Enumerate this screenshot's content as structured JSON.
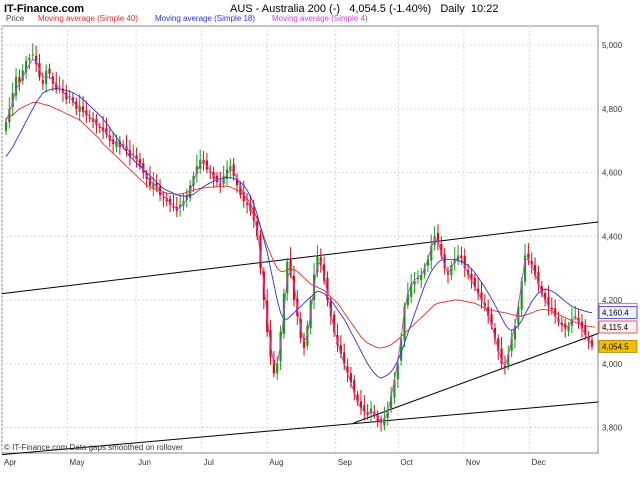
{
  "header": {
    "brand": "IT-Finance.com",
    "symbol": "AUS - Australia 200 (-)",
    "quote": "4,054.5 (-1.40%)",
    "period": "Daily",
    "time": "10:22"
  },
  "legend": {
    "price": "Price",
    "ma40": "Moving average (Simple 40)",
    "ma18": "Moving average (Simple 18)",
    "ma4": "Moving average (Simple 4)"
  },
  "footer": {
    "note": "© IT-Finance.com  Data gaps smoothed on rollover"
  },
  "chart_data": {
    "type": "candlestick",
    "title": "AUS - Australia 200 (-)",
    "x_ticks": [
      "Apr",
      "May",
      "Jun",
      "Jul",
      "Aug",
      "Sep",
      "Oct",
      "Nov",
      "Dec"
    ],
    "y_ticks": [
      "3,800",
      "4,000",
      "4,200",
      "4,400",
      "4,600",
      "4,800",
      "5,000"
    ],
    "ylim": [
      3720,
      5060
    ],
    "grid": true,
    "price_tags": {
      "ma4": "4,170.9",
      "ma18": "4,160.4",
      "ma40": "4,115.4",
      "last": "4,054.5"
    },
    "colors": {
      "up": "#1a9a1a",
      "down": "#cc1111",
      "ma40": "#e03030",
      "ma18": "#3030d0",
      "ma4": "#d040d0",
      "last_tag": "#f0c000"
    },
    "closes": [
      4760,
      4800,
      4850,
      4900,
      4880,
      4920,
      4950,
      4960,
      4970,
      4940,
      4900,
      4880,
      4920,
      4910,
      4880,
      4860,
      4870,
      4850,
      4830,
      4840,
      4820,
      4800,
      4810,
      4790,
      4780,
      4770,
      4760,
      4750,
      4740,
      4730,
      4720,
      4700,
      4690,
      4700,
      4680,
      4690,
      4670,
      4650,
      4660,
      4640,
      4620,
      4600,
      4580,
      4560,
      4570,
      4550,
      4530,
      4520,
      4510,
      4500,
      4490,
      4480,
      4500,
      4510,
      4530,
      4560,
      4590,
      4620,
      4640,
      4630,
      4610,
      4600,
      4580,
      4570,
      4560,
      4590,
      4610,
      4620,
      4590,
      4560,
      4530,
      4510,
      4500,
      4480,
      4450,
      4400,
      4300,
      4200,
      4100,
      4020,
      3970,
      4000,
      4100,
      4220,
      4320,
      4280,
      4200,
      4150,
      4080,
      4050,
      4120,
      4200,
      4280,
      4340,
      4310,
      4260,
      4200,
      4150,
      4100,
      4060,
      4030,
      4000,
      3970,
      3940,
      3910,
      3880,
      3860,
      3850,
      3840,
      3860,
      3840,
      3820,
      3815,
      3830,
      3850,
      3900,
      3950,
      4000,
      4080,
      4180,
      4220,
      4250,
      4260,
      4270,
      4280,
      4300,
      4330,
      4370,
      4400,
      4380,
      4340,
      4300,
      4280,
      4310,
      4330,
      4340,
      4330,
      4300,
      4280,
      4260,
      4240,
      4220,
      4200,
      4180,
      4150,
      4120,
      4080,
      4040,
      4000,
      3990,
      4030,
      4080,
      4120,
      4180,
      4260,
      4340,
      4330,
      4310,
      4280,
      4250,
      4220,
      4200,
      4180,
      4170,
      4150,
      4130,
      4120,
      4110,
      4120,
      4140,
      4150,
      4130,
      4110,
      4090,
      4070,
      4054.5
    ],
    "ma40": [
      4770,
      4775,
      4780,
      4790,
      4800,
      4805,
      4810,
      4815,
      4820,
      4820,
      4818,
      4815,
      4812,
      4810,
      4805,
      4800,
      4795,
      4790,
      4785,
      4780,
      4775,
      4770,
      4765,
      4755,
      4745,
      4735,
      4725,
      4715,
      4705,
      4690,
      4680,
      4670,
      4660,
      4650,
      4640,
      4630,
      4620,
      4610,
      4600,
      4590,
      4580,
      4570,
      4560,
      4555,
      4550,
      4545,
      4540,
      4538,
      4536,
      4534,
      4533,
      4532,
      4533,
      4535,
      4538,
      4542,
      4545,
      4548,
      4550,
      4552,
      4553,
      4554,
      4555,
      4556,
      4557,
      4558,
      4557,
      4555,
      4550,
      4545,
      4540,
      4530,
      4520,
      4500,
      4480,
      4455,
      4430,
      4400,
      4370,
      4345,
      4320,
      4300,
      4290,
      4290,
      4295,
      4298,
      4295,
      4290,
      4280,
      4270,
      4260,
      4250,
      4245,
      4240,
      4235,
      4230,
      4220,
      4210,
      4200,
      4190,
      4175,
      4160,
      4145,
      4130,
      4115,
      4100,
      4085,
      4075,
      4065,
      4060,
      4055,
      4050,
      4050,
      4052,
      4055,
      4060,
      4068,
      4076,
      4085,
      4095,
      4105,
      4115,
      4125,
      4135,
      4145,
      4155,
      4165,
      4175,
      4185,
      4190,
      4192,
      4194,
      4196,
      4198,
      4200,
      4200,
      4198,
      4196,
      4194,
      4192,
      4190,
      4185,
      4180,
      4175,
      4170,
      4168,
      4166,
      4164,
      4162,
      4160,
      4158,
      4155,
      4152,
      4150,
      4150,
      4152,
      4156,
      4160,
      4164,
      4168,
      4170,
      4170,
      4168,
      4165,
      4160,
      4155,
      4150,
      4145,
      4140,
      4135,
      4130,
      4126,
      4122,
      4120,
      4118,
      4116,
      4115.4
    ],
    "ma18": [
      4650,
      4665,
      4680,
      4700,
      4720,
      4740,
      4760,
      4780,
      4800,
      4820,
      4835,
      4850,
      4855,
      4860,
      4862,
      4864,
      4862,
      4860,
      4858,
      4855,
      4850,
      4845,
      4838,
      4830,
      4820,
      4810,
      4800,
      4790,
      4780,
      4768,
      4755,
      4740,
      4725,
      4710,
      4695,
      4680,
      4665,
      4650,
      4640,
      4630,
      4620,
      4610,
      4600,
      4590,
      4580,
      4570,
      4560,
      4550,
      4545,
      4540,
      4535,
      4530,
      4528,
      4526,
      4526,
      4528,
      4532,
      4540,
      4548,
      4556,
      4562,
      4568,
      4574,
      4578,
      4580,
      4582,
      4584,
      4584,
      4582,
      4578,
      4570,
      4560,
      4545,
      4525,
      4500,
      4470,
      4430,
      4390,
      4350,
      4300,
      4250,
      4200,
      4160,
      4140,
      4140,
      4150,
      4160,
      4170,
      4180,
      4190,
      4200,
      4210,
      4220,
      4228,
      4225,
      4220,
      4210,
      4200,
      4185,
      4170,
      4155,
      4140,
      4120,
      4100,
      4080,
      4060,
      4040,
      4020,
      4000,
      3985,
      3970,
      3960,
      3955,
      3960,
      3965,
      3975,
      3990,
      4010,
      4035,
      4065,
      4095,
      4125,
      4155,
      4185,
      4215,
      4245,
      4268,
      4290,
      4305,
      4318,
      4325,
      4328,
      4328,
      4327,
      4326,
      4324,
      4320,
      4315,
      4308,
      4298,
      4286,
      4272,
      4256,
      4240,
      4222,
      4204,
      4185,
      4165,
      4145,
      4125,
      4110,
      4105,
      4110,
      4120,
      4135,
      4155,
      4175,
      4195,
      4210,
      4222,
      4230,
      4235,
      4232,
      4228,
      4222,
      4214,
      4205,
      4196,
      4188,
      4180,
      4175,
      4172,
      4168,
      4165,
      4162,
      4160.4
    ],
    "ma4": [
      4760,
      4790,
      4820,
      4860,
      4880,
      4900,
      4920,
      4940,
      4955,
      4950,
      4925,
      4900,
      4900,
      4900,
      4890,
      4875,
      4865,
      4855,
      4840,
      4835,
      4825,
      4810,
      4805,
      4795,
      4785,
      4775,
      4765,
      4755,
      4745,
      4735,
      4725,
      4708,
      4695,
      4692,
      4688,
      4686,
      4678,
      4662,
      4655,
      4642,
      4628,
      4610,
      4590,
      4572,
      4566,
      4556,
      4540,
      4528,
      4516,
      4506,
      4496,
      4486,
      4490,
      4502,
      4518,
      4542,
      4572,
      4602,
      4628,
      4632,
      4622,
      4606,
      4590,
      4576,
      4568,
      4576,
      4594,
      4610,
      4602,
      4582,
      4556,
      4530,
      4510,
      4490,
      4462,
      4420,
      4340,
      4250,
      4150,
      4060,
      4000,
      4000,
      4060,
      4160,
      4270,
      4290,
      4250,
      4180,
      4110,
      4070,
      4090,
      4160,
      4240,
      4310,
      4320,
      4280,
      4220,
      4160,
      4110,
      4070,
      4030,
      4000,
      3970,
      3940,
      3910,
      3880,
      3860,
      3850,
      3845,
      3850,
      3848,
      3830,
      3818,
      3825,
      3850,
      3895,
      3950,
      4008,
      4080,
      4170,
      4220,
      4248,
      4262,
      4270,
      4280,
      4298,
      4328,
      4365,
      4392,
      4385,
      4348,
      4308,
      4285,
      4300,
      4322,
      4336,
      4332,
      4306,
      4284,
      4262,
      4242,
      4222,
      4202,
      4182,
      4154,
      4122,
      4086,
      4046,
      4008,
      3995,
      4024,
      4076,
      4122,
      4182,
      4256,
      4326,
      4328,
      4312,
      4284,
      4254,
      4224,
      4202,
      4182,
      4168,
      4152,
      4134,
      4122,
      4114,
      4118,
      4136,
      4148,
      4134,
      4112,
      4092,
      4074,
      4060
    ]
  }
}
